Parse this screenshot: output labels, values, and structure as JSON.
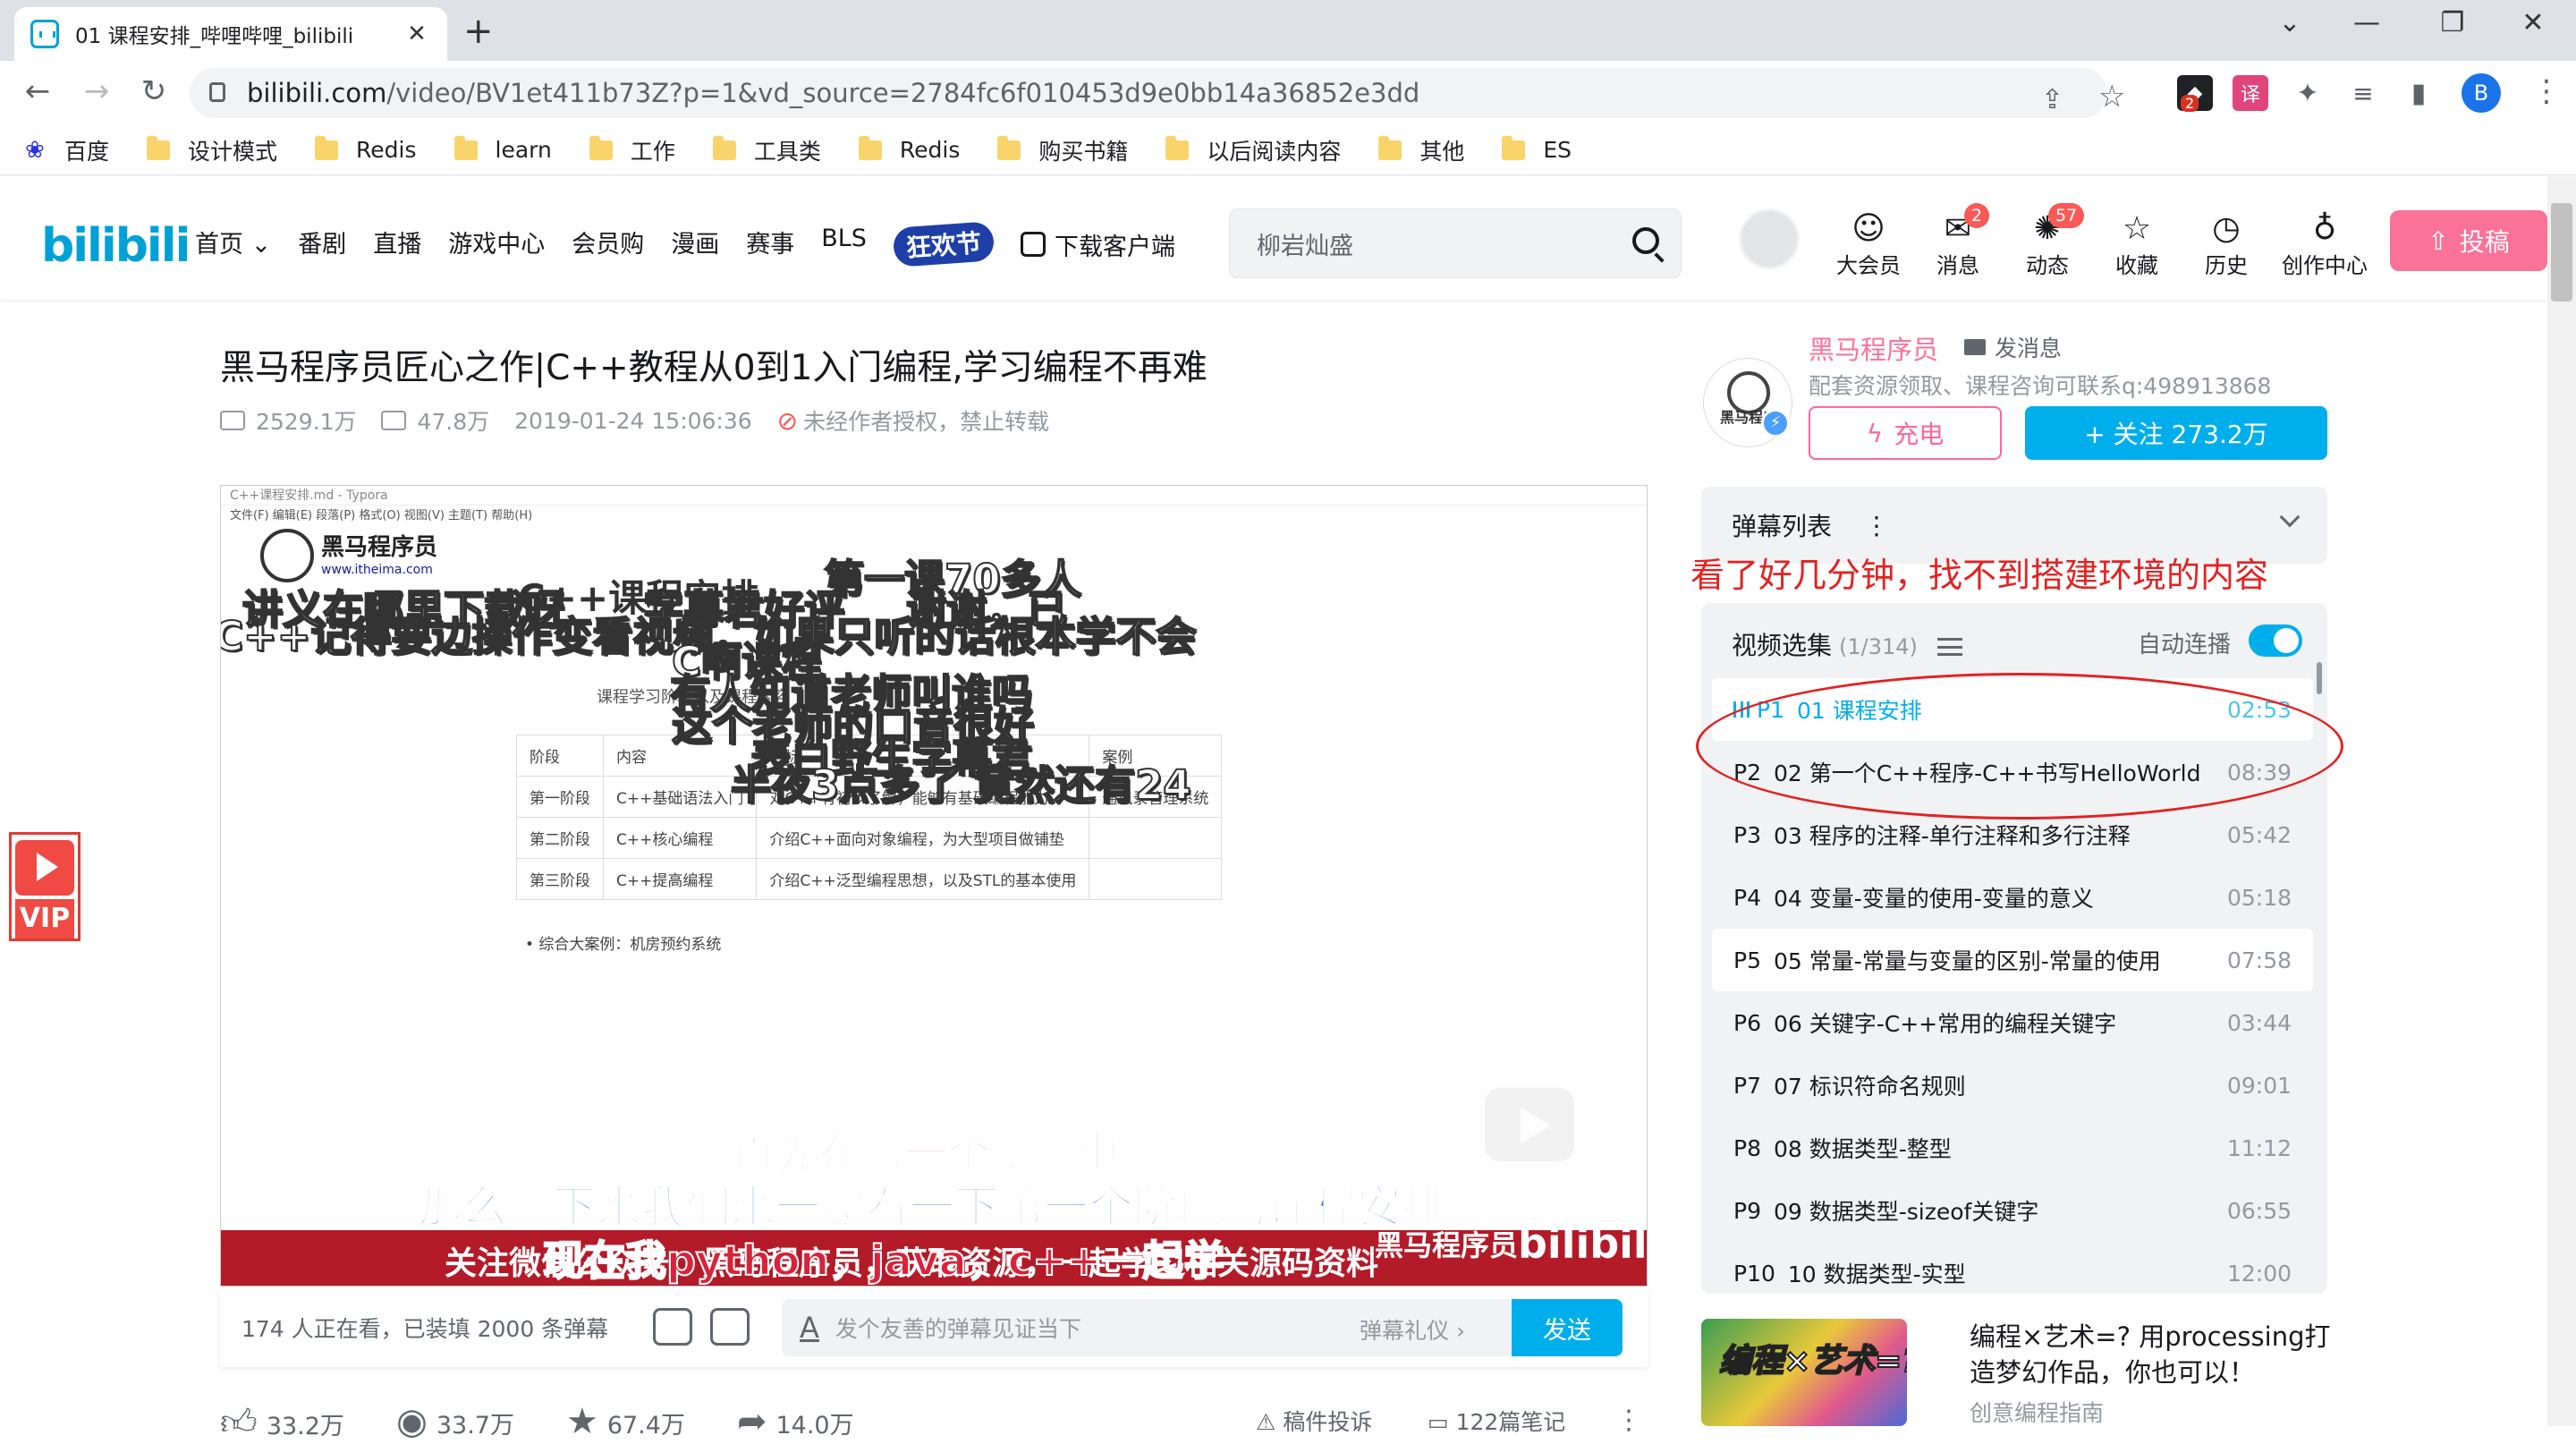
{
  "browser": {
    "tab_title": "01 课程安排_哔哩哔哩_bilibili",
    "tab_close": "✕",
    "new_tab": "+",
    "url_host": "bilibili.com",
    "url_path": "/video/BV1et411b73Z?p=1&vd_source=2784fc6f010453d9e0bb14a36852e3dd",
    "ext_badge": "2",
    "profile_letter": "B",
    "bookmarks": [
      "百度",
      "设计模式",
      "Redis",
      "learn",
      "工作",
      "工具类",
      "Redis",
      "购买书籍",
      "以后阅读内容",
      "其他",
      "ES"
    ]
  },
  "header": {
    "logo": "bilibili",
    "nav": [
      "首页 ⌄",
      "番剧",
      "直播",
      "游戏中心",
      "会员购",
      "漫画",
      "赛事",
      "BLS"
    ],
    "festival": "狂欢节",
    "download": "下载客户端",
    "search_placeholder": "柳岩灿盛",
    "icons": [
      {
        "label": "大会员",
        "glyph": "☺",
        "badge": ""
      },
      {
        "label": "消息",
        "glyph": "✉",
        "badge": "2"
      },
      {
        "label": "动态",
        "glyph": "✺",
        "badge": "57"
      },
      {
        "label": "收藏",
        "glyph": "☆",
        "badge": ""
      },
      {
        "label": "历史",
        "glyph": "◷",
        "badge": ""
      },
      {
        "label": "创作中心",
        "glyph": "♁",
        "badge": ""
      }
    ],
    "upload": "投稿"
  },
  "video": {
    "title": "黑马程序员匠心之作|C++教程从0到1入门编程,学习编程不再难",
    "views": "2529.1万",
    "danmaku_count": "47.8万",
    "date": "2019-01-24 15:06:36",
    "copyright": "未经作者授权，禁止转载"
  },
  "player": {
    "typora_title": "C++课程安排.md - Typora",
    "typora_menu": "文件(F)   编辑(E)   段落(P)   格式(O)   视图(V)   主题(T)   帮助(H)",
    "brand_name": "黑马程序员",
    "brand_url": "www.itheima.com",
    "doc_title": "C++课程安排",
    "doc_subtitle": "课程学习阶段以及课程内容",
    "table_header": [
      "阶段",
      "内容",
      "目标",
      "案例"
    ],
    "table_rows": [
      [
        "第一阶段",
        "C++基础语法入门",
        "对C++有初步了解，能够有基础编程能力",
        "通讯录管理系统"
      ],
      [
        "第二阶段",
        "C++核心编程",
        "介绍C++面向对象编程，为大型项目做铺垫",
        ""
      ],
      [
        "第三阶段",
        "C++提高编程",
        "介绍C++泛型编程思想，以及STL的基本使用",
        ""
      ]
    ],
    "doc_bullet": "• 综合大案例：机房预约系统",
    "danmaku": [
      "讲义在哪里下载呀",
      "字幕君好评",
      "第一课70多人",
      "谢谢，已",
      "C++记得要边操作变看视频，如果只听的话根本学不会",
      "C啊课程",
      "有人知道老师叫谁吗",
      "这个老师的口音很好",
      "表白野生字幕君",
      "半夜3点多了  竟然还有24"
    ],
    "subtitle_pink": "首先在第一个阶段中",
    "subtitle_blue": "那么接下来我们来一起看一下第一个阶段的课程安排",
    "banner_text": "关注微信公众号：黑马程序员，获取资源，一起学习相关源码资料",
    "banner_brand": "黑马程序员",
    "banner_logo": "bilibili",
    "subtitle_red": "现在我python，java，c++一起学"
  },
  "danmaku_bar": {
    "watching": "174 人正在看，已装填 2000 条弹幕",
    "input_placeholder": "发个友善的弹幕见证当下",
    "etiquette": "弹幕礼仪 ›",
    "send": "发送"
  },
  "actions": {
    "like": "33.2万",
    "coin": "33.7万",
    "fav": "67.4万",
    "share": "14.0万",
    "report": "稿件投诉",
    "notes": "122篇笔记"
  },
  "vip": "VIP",
  "uploader": {
    "name": "黑马程序员",
    "message": "发消息",
    "desc": "配套资源领取、课程咨询可联系q:498913868",
    "charge": "充电",
    "follow": "+ 关注 273.2万",
    "avatar_text": "黑马程序"
  },
  "danmaku_list": {
    "label": "弹幕列表",
    "kebab": "⋮"
  },
  "annotation": "看了好几分钟，找不到搭建环境的内容",
  "episodes": {
    "label": "视频选集",
    "count": "(1/314)",
    "autoplay": "自动连播",
    "items": [
      {
        "p": "P1",
        "title": "01 课程安排",
        "dur": "02:53"
      },
      {
        "p": "P2",
        "title": "02 第一个C++程序-C++书写HelloWorld",
        "dur": "08:39"
      },
      {
        "p": "P3",
        "title": "03 程序的注释-单行注释和多行注释",
        "dur": "05:42"
      },
      {
        "p": "P4",
        "title": "04 变量-变量的使用-变量的意义",
        "dur": "05:18"
      },
      {
        "p": "P5",
        "title": "05 常量-常量与变量的区别-常量的使用",
        "dur": "07:58"
      },
      {
        "p": "P6",
        "title": "06 关键字-C++常用的编程关键字",
        "dur": "03:44"
      },
      {
        "p": "P7",
        "title": "07 标识符命名规则",
        "dur": "09:01"
      },
      {
        "p": "P8",
        "title": "08 数据类型-整型",
        "dur": "11:12"
      },
      {
        "p": "P9",
        "title": "09 数据类型-sizeof关键字",
        "dur": "06:55"
      },
      {
        "p": "P10",
        "title": "10 数据类型-实型",
        "dur": "12:00"
      }
    ]
  },
  "recommend": {
    "thumb_text": "编程×艺术=?",
    "title": "编程×艺术=? 用processing打造梦幻作品，你也可以！",
    "author": "创意编程指南"
  }
}
